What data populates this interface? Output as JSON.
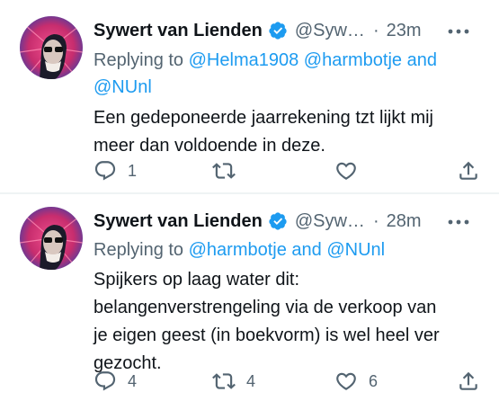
{
  "tweets": [
    {
      "author_name": "Sywert van Lienden",
      "handle": "@Syw…",
      "separator": "·",
      "time": "23m",
      "replying_to_prefix": "Replying to ",
      "replying_to_1": "@Helma1908",
      "replying_to_2": "@harmbotje",
      "replying_to_and": " and ",
      "replying_to_3": "@NUnl",
      "text": "Een gedeponeerde jaarrekening tzt lijkt mij\nmeer dan voldoende in deze.",
      "reply_count": "1",
      "retweet_count": "",
      "like_count": ""
    },
    {
      "author_name": "Sywert van Lienden",
      "handle": "@Syw…",
      "separator": "·",
      "time": "28m",
      "replying_to_prefix": "Replying to ",
      "replying_to_1": "@harmbotje",
      "replying_to_and": " and ",
      "replying_to_2": "@NUnl",
      "text": "Spijkers op laag water dit:\nbelangenverstrengeling via de verkoop van\nje eigen geest (in boekvorm) is wel heel ver\ngezocht.",
      "reply_count": "4",
      "retweet_count": "4",
      "like_count": "6"
    }
  ],
  "icons": {
    "verified": "verified-badge-icon",
    "more": "more-horizontal-icon",
    "reply": "reply-bubble-icon",
    "retweet": "retweet-icon",
    "like": "heart-icon",
    "share": "share-icon"
  },
  "colors": {
    "text": "#0f1419",
    "secondary": "#536471",
    "accent": "#1d9bf0",
    "divider": "#eff3f4"
  }
}
